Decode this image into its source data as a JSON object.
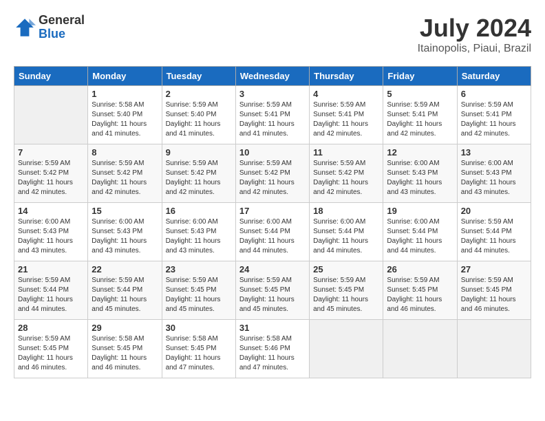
{
  "logo": {
    "general": "General",
    "blue": "Blue"
  },
  "title": "July 2024",
  "subtitle": "Itainopolis, Piaui, Brazil",
  "days_of_week": [
    "Sunday",
    "Monday",
    "Tuesday",
    "Wednesday",
    "Thursday",
    "Friday",
    "Saturday"
  ],
  "weeks": [
    [
      {
        "day": "",
        "info": ""
      },
      {
        "day": "1",
        "info": "Sunrise: 5:58 AM\nSunset: 5:40 PM\nDaylight: 11 hours\nand 41 minutes."
      },
      {
        "day": "2",
        "info": "Sunrise: 5:59 AM\nSunset: 5:40 PM\nDaylight: 11 hours\nand 41 minutes."
      },
      {
        "day": "3",
        "info": "Sunrise: 5:59 AM\nSunset: 5:41 PM\nDaylight: 11 hours\nand 41 minutes."
      },
      {
        "day": "4",
        "info": "Sunrise: 5:59 AM\nSunset: 5:41 PM\nDaylight: 11 hours\nand 42 minutes."
      },
      {
        "day": "5",
        "info": "Sunrise: 5:59 AM\nSunset: 5:41 PM\nDaylight: 11 hours\nand 42 minutes."
      },
      {
        "day": "6",
        "info": "Sunrise: 5:59 AM\nSunset: 5:41 PM\nDaylight: 11 hours\nand 42 minutes."
      }
    ],
    [
      {
        "day": "7",
        "info": "Sunrise: 5:59 AM\nSunset: 5:42 PM\nDaylight: 11 hours\nand 42 minutes."
      },
      {
        "day": "8",
        "info": "Sunrise: 5:59 AM\nSunset: 5:42 PM\nDaylight: 11 hours\nand 42 minutes."
      },
      {
        "day": "9",
        "info": "Sunrise: 5:59 AM\nSunset: 5:42 PM\nDaylight: 11 hours\nand 42 minutes."
      },
      {
        "day": "10",
        "info": "Sunrise: 5:59 AM\nSunset: 5:42 PM\nDaylight: 11 hours\nand 42 minutes."
      },
      {
        "day": "11",
        "info": "Sunrise: 5:59 AM\nSunset: 5:42 PM\nDaylight: 11 hours\nand 42 minutes."
      },
      {
        "day": "12",
        "info": "Sunrise: 6:00 AM\nSunset: 5:43 PM\nDaylight: 11 hours\nand 43 minutes."
      },
      {
        "day": "13",
        "info": "Sunrise: 6:00 AM\nSunset: 5:43 PM\nDaylight: 11 hours\nand 43 minutes."
      }
    ],
    [
      {
        "day": "14",
        "info": "Sunrise: 6:00 AM\nSunset: 5:43 PM\nDaylight: 11 hours\nand 43 minutes."
      },
      {
        "day": "15",
        "info": "Sunrise: 6:00 AM\nSunset: 5:43 PM\nDaylight: 11 hours\nand 43 minutes."
      },
      {
        "day": "16",
        "info": "Sunrise: 6:00 AM\nSunset: 5:43 PM\nDaylight: 11 hours\nand 43 minutes."
      },
      {
        "day": "17",
        "info": "Sunrise: 6:00 AM\nSunset: 5:44 PM\nDaylight: 11 hours\nand 44 minutes."
      },
      {
        "day": "18",
        "info": "Sunrise: 6:00 AM\nSunset: 5:44 PM\nDaylight: 11 hours\nand 44 minutes."
      },
      {
        "day": "19",
        "info": "Sunrise: 6:00 AM\nSunset: 5:44 PM\nDaylight: 11 hours\nand 44 minutes."
      },
      {
        "day": "20",
        "info": "Sunrise: 5:59 AM\nSunset: 5:44 PM\nDaylight: 11 hours\nand 44 minutes."
      }
    ],
    [
      {
        "day": "21",
        "info": "Sunrise: 5:59 AM\nSunset: 5:44 PM\nDaylight: 11 hours\nand 44 minutes."
      },
      {
        "day": "22",
        "info": "Sunrise: 5:59 AM\nSunset: 5:44 PM\nDaylight: 11 hours\nand 45 minutes."
      },
      {
        "day": "23",
        "info": "Sunrise: 5:59 AM\nSunset: 5:45 PM\nDaylight: 11 hours\nand 45 minutes."
      },
      {
        "day": "24",
        "info": "Sunrise: 5:59 AM\nSunset: 5:45 PM\nDaylight: 11 hours\nand 45 minutes."
      },
      {
        "day": "25",
        "info": "Sunrise: 5:59 AM\nSunset: 5:45 PM\nDaylight: 11 hours\nand 45 minutes."
      },
      {
        "day": "26",
        "info": "Sunrise: 5:59 AM\nSunset: 5:45 PM\nDaylight: 11 hours\nand 46 minutes."
      },
      {
        "day": "27",
        "info": "Sunrise: 5:59 AM\nSunset: 5:45 PM\nDaylight: 11 hours\nand 46 minutes."
      }
    ],
    [
      {
        "day": "28",
        "info": "Sunrise: 5:59 AM\nSunset: 5:45 PM\nDaylight: 11 hours\nand 46 minutes."
      },
      {
        "day": "29",
        "info": "Sunrise: 5:58 AM\nSunset: 5:45 PM\nDaylight: 11 hours\nand 46 minutes."
      },
      {
        "day": "30",
        "info": "Sunrise: 5:58 AM\nSunset: 5:45 PM\nDaylight: 11 hours\nand 47 minutes."
      },
      {
        "day": "31",
        "info": "Sunrise: 5:58 AM\nSunset: 5:46 PM\nDaylight: 11 hours\nand 47 minutes."
      },
      {
        "day": "",
        "info": ""
      },
      {
        "day": "",
        "info": ""
      },
      {
        "day": "",
        "info": ""
      }
    ]
  ]
}
